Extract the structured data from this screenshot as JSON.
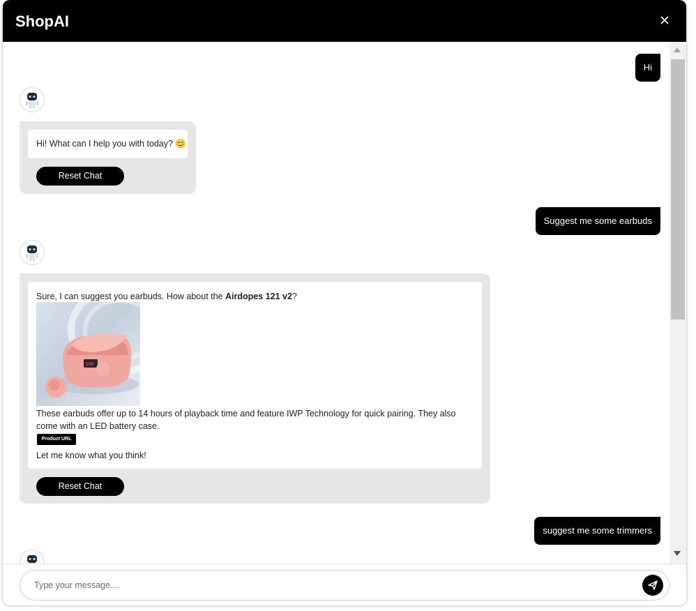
{
  "app": {
    "title": "ShopAI"
  },
  "messages": {
    "user1": "Hi",
    "bot1": {
      "text": "Hi! What can I help you with today? 😊",
      "reset_label": "Reset Chat"
    },
    "user2": "Suggest me some earbuds",
    "bot2": {
      "intro_pre": "Sure, I can suggest you earbuds. How about the ",
      "product_name": "Airdopes 121 v2",
      "intro_post": "?",
      "description": "These earbuds offer up to 14 hours of playback time and feature IWP Technology for quick pairing. They also come with an LED battery case.",
      "url_label": "Product URL",
      "closing": "Let me know what you think!",
      "reset_label": "Reset Chat"
    },
    "user3": "suggest me some trimmers"
  },
  "input": {
    "placeholder": "Type your message...."
  },
  "icons": {
    "close": "close-icon",
    "send": "send-icon",
    "bot": "robot-icon"
  },
  "colors": {
    "header": "#000000",
    "bot_bubble": "#e6e6e6",
    "user_bubble": "#000000"
  }
}
